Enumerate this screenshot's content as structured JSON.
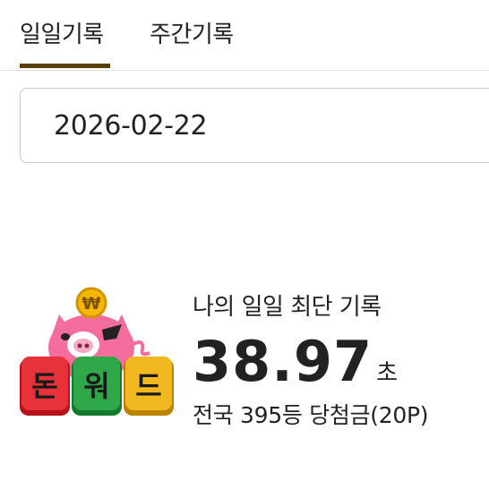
{
  "tabs": [
    {
      "label": "일일기록",
      "active": true
    },
    {
      "label": "주간기록",
      "active": false
    }
  ],
  "date_field": {
    "value": "2026-02-22"
  },
  "logo": {
    "coin_symbol": "₩",
    "tiles": [
      "돈",
      "워",
      "드"
    ],
    "tile_colors": [
      "#e8323a",
      "#2fa84a",
      "#f2b820"
    ],
    "pig_color": "#f46d9e"
  },
  "record": {
    "label": "나의 일일 최단 기록",
    "time": "38.97",
    "unit": "초",
    "rank_text": "전국 395등 당첨금(20P)"
  },
  "colors": {
    "accent": "#5a4008",
    "border": "#c8c8c8"
  }
}
